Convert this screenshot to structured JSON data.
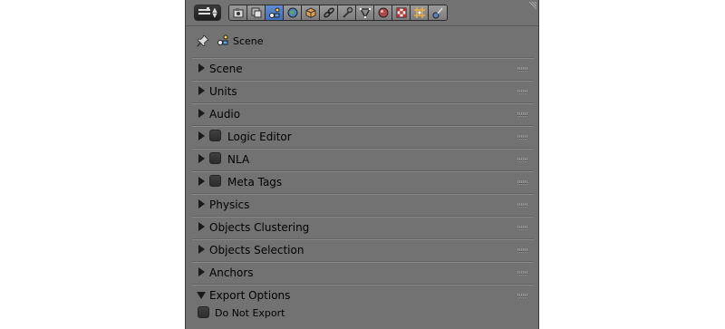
{
  "context": {
    "label": "Scene"
  },
  "header": {
    "tabs": [
      {
        "name": "render-tab-icon",
        "active": false
      },
      {
        "name": "render-layers-tab-icon",
        "active": false
      },
      {
        "name": "scene-tab-icon",
        "active": true
      },
      {
        "name": "world-tab-icon",
        "active": false
      },
      {
        "name": "object-tab-icon",
        "active": false
      },
      {
        "name": "constraints-tab-icon",
        "active": false
      },
      {
        "name": "modifiers-tab-icon",
        "active": false
      },
      {
        "name": "data-tab-icon",
        "active": false
      },
      {
        "name": "material-tab-icon",
        "active": false
      },
      {
        "name": "texture-tab-icon",
        "active": false
      },
      {
        "name": "particles-tab-icon",
        "active": false
      },
      {
        "name": "physics-tab-icon",
        "active": false
      }
    ]
  },
  "panels": [
    {
      "label": "Scene",
      "checkbox": false,
      "open": false
    },
    {
      "label": "Units",
      "checkbox": false,
      "open": false
    },
    {
      "label": "Audio",
      "checkbox": false,
      "open": false
    },
    {
      "label": "Logic Editor",
      "checkbox": true,
      "checked": false,
      "open": false
    },
    {
      "label": "NLA",
      "checkbox": true,
      "checked": false,
      "open": false
    },
    {
      "label": "Meta Tags",
      "checkbox": true,
      "checked": false,
      "open": false
    },
    {
      "label": "Physics",
      "checkbox": false,
      "open": false
    },
    {
      "label": "Objects Clustering",
      "checkbox": false,
      "open": false
    },
    {
      "label": "Objects Selection",
      "checkbox": false,
      "open": false
    },
    {
      "label": "Anchors",
      "checkbox": false,
      "open": false
    },
    {
      "label": "Export Options",
      "checkbox": false,
      "open": true
    }
  ],
  "export_options": {
    "do_not_export_label": "Do Not Export",
    "do_not_export_checked": false
  }
}
